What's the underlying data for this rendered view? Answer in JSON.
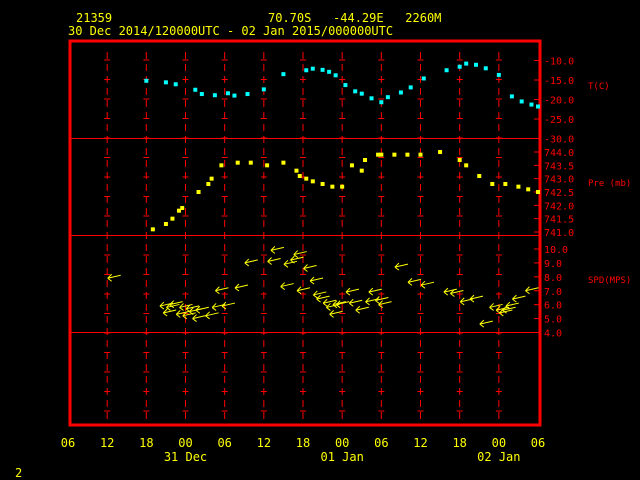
{
  "header": {
    "station": "21359",
    "location": "70.70S   -44.29E   2260M",
    "period": "30 Dec 2014/120000UTC - 02 Jan 2015/000000UTC"
  },
  "corner_label": "2",
  "colors": {
    "frame": "#ff0000",
    "header_text": "#ffff00",
    "temperature": "#00ffff",
    "pressure": "#ffff00",
    "wind": "#ffff00",
    "axis_text": "#ffff00",
    "panel_text": "#ff0000"
  },
  "chart_data": {
    "type": "scatter",
    "x_axis": {
      "tick_labels": [
        "06",
        "12",
        "18",
        "00",
        "06",
        "12",
        "18",
        "00",
        "06",
        "12",
        "18",
        "00",
        "06"
      ],
      "day_labels": [
        "31 Dec",
        "01 Jan",
        "02 Jan"
      ]
    },
    "panels": [
      {
        "name": "temperature",
        "label": "T(C)",
        "ticks": [
          "-10.0",
          "-15.0",
          "-20.0",
          "-25.0",
          "-30.0"
        ],
        "ylim": [
          -30,
          -7.2
        ],
        "x": [
          12,
          15,
          16.5,
          19.5,
          20.5,
          22.5,
          24.5,
          25.5,
          27.5,
          30,
          33,
          36.5,
          37.5,
          39,
          40,
          41,
          42.5,
          44,
          45,
          46.5,
          48,
          49,
          51,
          52.5,
          54.5,
          58,
          60,
          61,
          62.5,
          64,
          66,
          68,
          69.5,
          71,
          72
        ],
        "values": [
          -15.2,
          -15.6,
          -16.1,
          -17.5,
          -18.6,
          -18.9,
          -18.4,
          -19.0,
          -18.6,
          -17.4,
          -13.5,
          -12.5,
          -12.1,
          -12.4,
          -12.9,
          -13.8,
          -16.3,
          -17.9,
          -18.5,
          -19.7,
          -20.7,
          -19.4,
          -18.2,
          -16.9,
          -14.6,
          -12.5,
          -11.6,
          -10.8,
          -11.1,
          -12.0,
          -13.7,
          -19.2,
          -20.5,
          -21.3,
          -21.8
        ]
      },
      {
        "name": "pressure",
        "label": "Pre (mb)",
        "ticks": [
          "744.0",
          "743.5",
          "743.0",
          "742.5",
          "742.0",
          "741.5",
          "741.0"
        ],
        "ylim": [
          740.6,
          744.3
        ],
        "x": [
          13,
          15,
          16,
          17,
          17.5,
          20,
          21.5,
          22,
          23.5,
          26,
          28,
          30.5,
          33,
          35,
          35.5,
          36.5,
          37.5,
          39,
          40.5,
          42,
          43.5,
          45,
          45.5,
          47.5,
          48,
          50,
          52,
          54,
          57,
          60,
          61,
          63,
          65,
          67,
          69,
          70.5,
          72
        ],
        "values": [
          741.1,
          741.3,
          741.5,
          741.8,
          741.9,
          742.5,
          742.8,
          743.0,
          743.5,
          743.6,
          743.6,
          743.5,
          743.6,
          743.3,
          743.1,
          743.0,
          742.9,
          742.8,
          742.7,
          742.7,
          743.5,
          743.3,
          743.7,
          743.9,
          743.9,
          743.9,
          743.9,
          743.9,
          744.0,
          743.7,
          743.5,
          743.1,
          742.8,
          742.8,
          742.7,
          742.6,
          742.5
        ]
      },
      {
        "name": "wind_speed",
        "label": "SPD(MPS)",
        "ticks": [
          "10.0",
          "9.0",
          "8.0",
          "7.0",
          "6.0",
          "5.0",
          "4.0"
        ],
        "ylim": [
          3.55,
          10.45
        ],
        "x": [
          7,
          15,
          15.5,
          16,
          16.5,
          17.5,
          18,
          18.5,
          19,
          19.5,
          20,
          20.5,
          22,
          23,
          23.5,
          24.5,
          26.5,
          28,
          31.5,
          32,
          33.5,
          34,
          35,
          35.5,
          36,
          37,
          38,
          38.5,
          39,
          40,
          40.5,
          41,
          41.5,
          42,
          43.5,
          44,
          45,
          46.5,
          47,
          48,
          48.5,
          51,
          53,
          55,
          58.5,
          59.5,
          61,
          62.5,
          64,
          65.5,
          66.5,
          67,
          67.5,
          68,
          69,
          71
        ],
        "values": [
          7.9,
          5.9,
          5.4,
          5.8,
          6.0,
          5.3,
          5.8,
          5.2,
          5.7,
          5.5,
          5.0,
          5.6,
          5.2,
          5.8,
          7.0,
          5.9,
          7.2,
          9.0,
          9.1,
          9.9,
          7.3,
          8.9,
          9.2,
          9.6,
          7.0,
          8.6,
          7.7,
          6.7,
          6.4,
          6.1,
          5.8,
          5.3,
          6.0,
          6.0,
          6.9,
          6.1,
          5.6,
          6.2,
          6.9,
          6.3,
          6.0,
          8.7,
          7.6,
          7.4,
          6.9,
          6.8,
          6.2,
          6.4,
          4.6,
          5.8,
          5.6,
          5.4,
          5.6,
          5.9,
          6.4,
          7.0
        ]
      }
    ]
  }
}
